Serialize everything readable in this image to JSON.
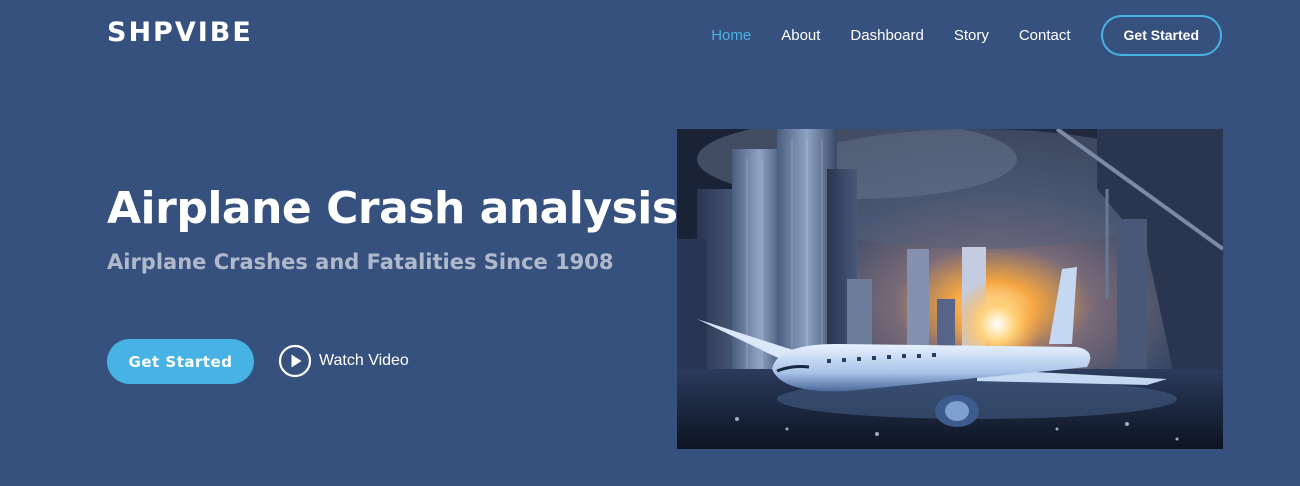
{
  "brand": {
    "logo_text": "SHPVIBE"
  },
  "nav": {
    "items": [
      {
        "label": "Home",
        "active": true
      },
      {
        "label": "About"
      },
      {
        "label": "Dashboard"
      },
      {
        "label": "Story"
      },
      {
        "label": "Contact"
      }
    ],
    "cta_label": "Get Started"
  },
  "hero": {
    "title": "Airplane Crash analysis",
    "subtitle": "Airplane Crashes and Fatalities Since 1908",
    "primary_button_label": "Get Started",
    "video_button_label": "Watch Video",
    "video_icon": "play-circle-icon",
    "image_subject": "crashed airliner among city skyscrapers at stormy sunset"
  },
  "colors": {
    "background": "#37517e",
    "accent": "#47b2e4",
    "text": "#ffffff",
    "subtitle": "rgba(255,255,255,0.6)"
  }
}
